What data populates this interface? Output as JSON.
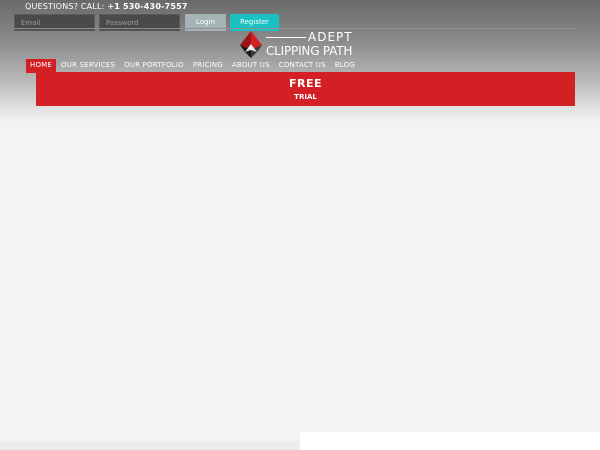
{
  "topbar": {
    "contact_label": "QUESTIONS? CALL:",
    "phone": "+1 530-430-7557",
    "email_placeholder": "Email",
    "password_placeholder": "Password",
    "login_label": "Login",
    "register_label": "Register"
  },
  "logo": {
    "line1": "ADEPT",
    "line2": "CLIPPING PATH",
    "icon": "logo-icon"
  },
  "nav": {
    "items": [
      {
        "label": "HOME",
        "active": true
      },
      {
        "label": "OUR SERVICES"
      },
      {
        "label": "OUR PORTFOLIO"
      },
      {
        "label": "PRICING"
      },
      {
        "label": "ABOUT US"
      },
      {
        "label": "CONTACT US"
      },
      {
        "label": "BLOG"
      }
    ]
  },
  "banner": {
    "title": "FREE",
    "subtitle": "TRIAL"
  },
  "colors": {
    "accent_red": "#d22024",
    "register_teal": "#19c1c3",
    "login_gray": "#a4b4b6"
  }
}
